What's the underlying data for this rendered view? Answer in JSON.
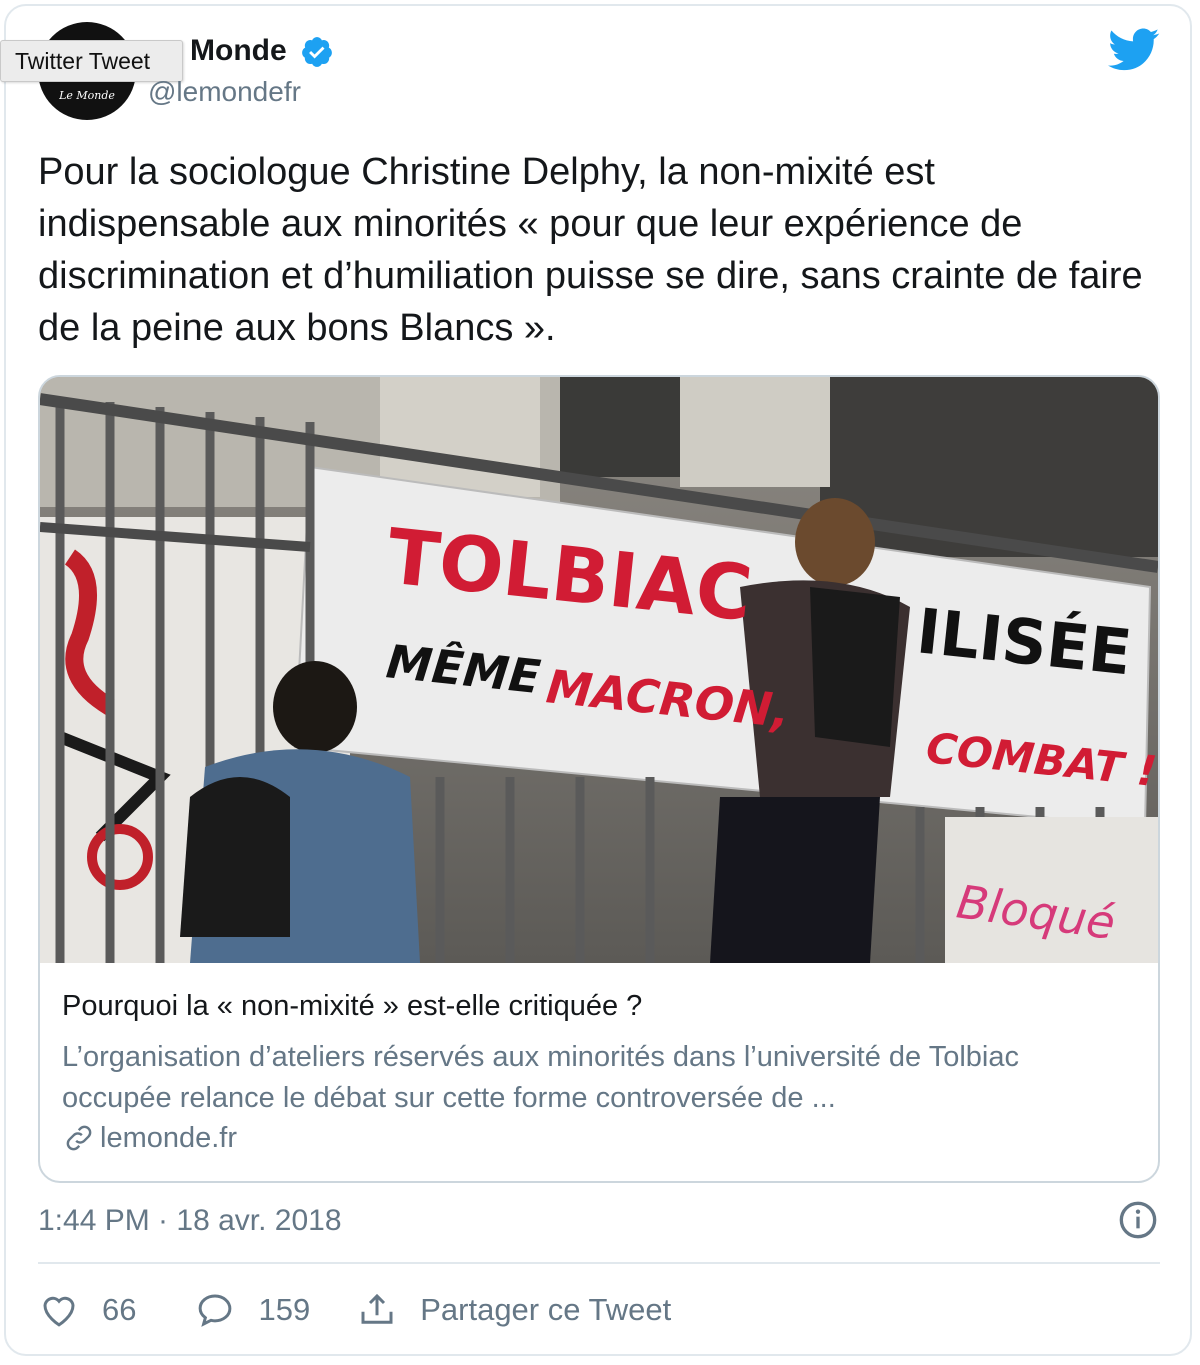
{
  "tooltip": {
    "label": "Twitter Tweet"
  },
  "author": {
    "name": "Monde",
    "handle": "@lemondefr",
    "avatar_text": "Le Monde",
    "verified": true
  },
  "tweet": {
    "text": "Pour la sociologue Christine Delphy, la non-mixité est indispensable aux minorités « pour que leur expérience de discrimination et d’humiliation puisse se dire, sans crainte de faire de la peine aux bons Blancs ».",
    "timestamp": "1:44 PM · 18 avr. 2018"
  },
  "link_card": {
    "title": "Pourquoi la « non-mixité » est-elle critiquée ?",
    "description": "L’organisation d’ateliers réservés aux minorités dans l’université de Tolbiac occupée relance le débat sur cette forme controversée de ...",
    "domain": "lemonde.fr",
    "banner_line1": "TOLBIAC",
    "banner_line1_end": "ILISÉE",
    "banner_line2_a": "MÊME",
    "banner_line2_b": "MACRON,",
    "banner_line2_c": "COMBAT !",
    "side_graffiti": "Bloqué"
  },
  "actions": {
    "likes": "66",
    "replies": "159",
    "share_label": "Partager ce Tweet"
  },
  "colors": {
    "accent": "#1da1f2",
    "text": "#14171a",
    "muted": "#657786",
    "border": "#e1e8ed"
  }
}
